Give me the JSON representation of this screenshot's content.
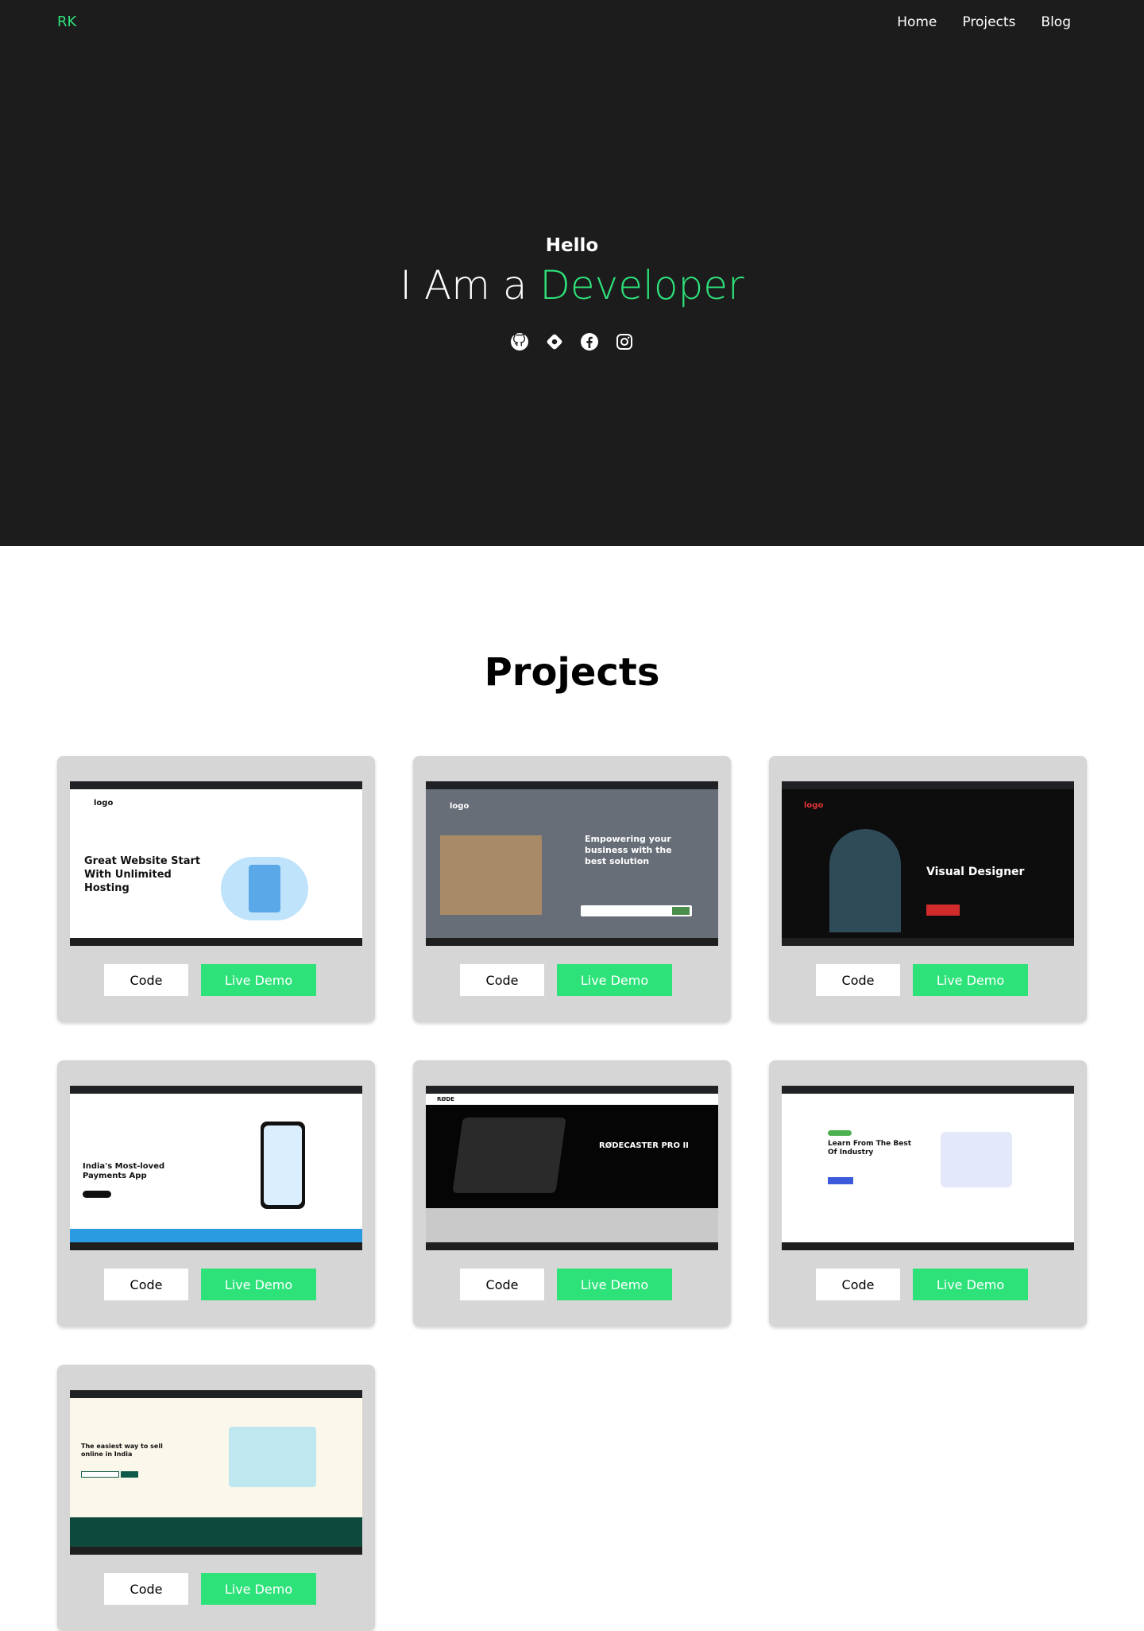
{
  "nav": {
    "logo": "RK",
    "links": [
      "Home",
      "Projects",
      "Blog"
    ]
  },
  "hero": {
    "greeting": "Hello",
    "headline_prefix": "I Am a",
    "headline_accent": "Developer",
    "social_icons": [
      "github-icon",
      "dev-icon",
      "facebook-icon",
      "instagram-icon"
    ]
  },
  "projects": {
    "title": "Projects",
    "cards": [
      {
        "code_label": "Code",
        "demo_label": "Live Demo",
        "preview_text": "Great Website Start With Unlimited Hosting",
        "preview_brand": "logo"
      },
      {
        "code_label": "Code",
        "demo_label": "Live Demo",
        "preview_text": "Empowering your business with the best solution",
        "preview_brand": "logo"
      },
      {
        "code_label": "Code",
        "demo_label": "Live Demo",
        "preview_text": "Visual Designer",
        "preview_brand": "logo"
      },
      {
        "code_label": "Code",
        "demo_label": "Live Demo",
        "preview_text": "India's Most-loved Payments App",
        "preview_brand": ""
      },
      {
        "code_label": "Code",
        "demo_label": "Live Demo",
        "preview_text": "RØDECASTER PRO II",
        "preview_brand": "RØDE"
      },
      {
        "code_label": "Code",
        "demo_label": "Live Demo",
        "preview_text": "Learn From The Best Of Industry",
        "preview_brand": ""
      },
      {
        "code_label": "Code",
        "demo_label": "Live Demo",
        "preview_text": "The easiest way to sell online in India",
        "preview_brand": ""
      }
    ]
  },
  "colors": {
    "accent": "#2ee27a",
    "hero_bg": "#1c1c1d",
    "card_bg": "#d6d6d6"
  }
}
